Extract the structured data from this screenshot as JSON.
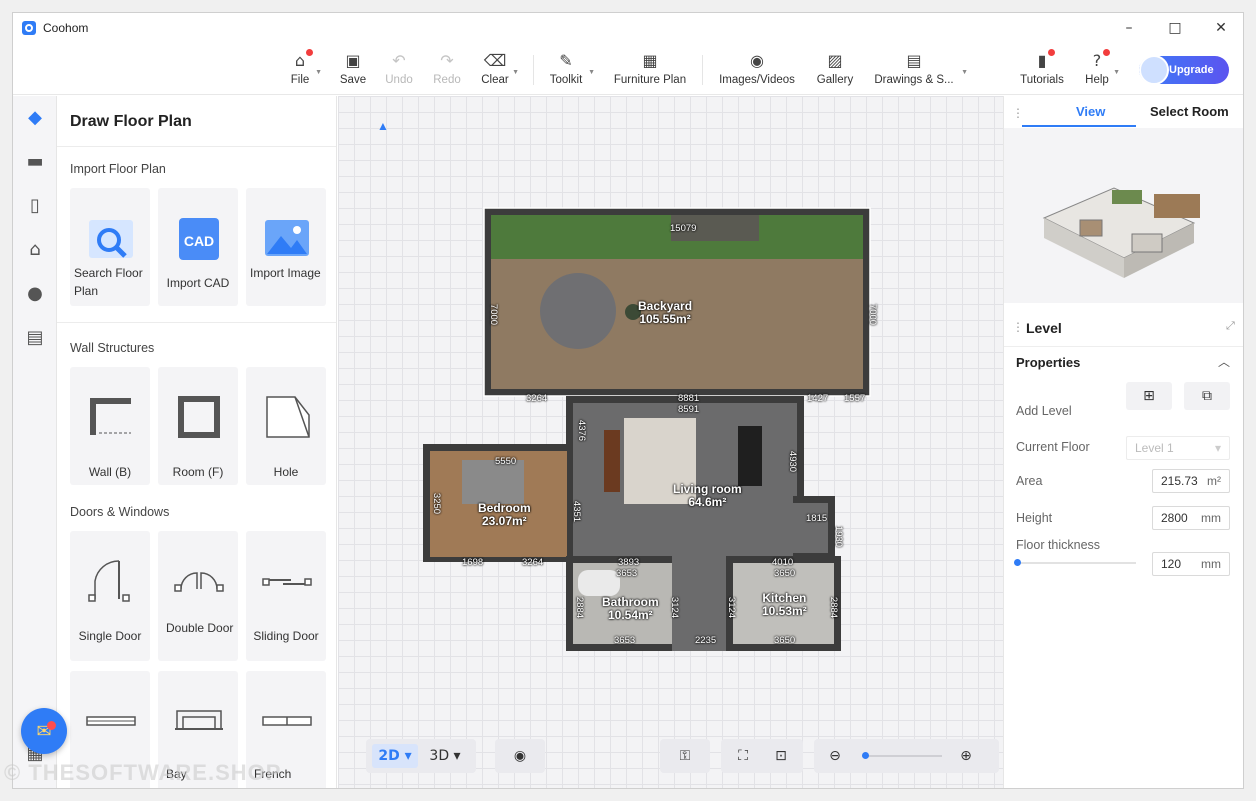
{
  "app": {
    "title": "Coohom"
  },
  "window_controls": {
    "minimize": "–",
    "maximize": "□",
    "close": "✕"
  },
  "toolbar": {
    "file": "File",
    "save": "Save",
    "undo": "Undo",
    "redo": "Redo",
    "clear": "Clear",
    "toolkit": "Toolkit",
    "furniture_plan": "Furniture Plan",
    "images_videos": "Images/Videos",
    "gallery": "Gallery",
    "drawings": "Drawings & S...",
    "tutorials": "Tutorials",
    "help": "Help",
    "upgrade": "Upgrade"
  },
  "left_panel": {
    "title": "Draw Floor Plan",
    "import_section": "Import Floor Plan",
    "import_items": [
      "Search Floor Plan",
      "Import CAD",
      "Import Image"
    ],
    "wall_section": "Wall Structures",
    "wall_items": [
      "Wall (B)",
      "Room (F)",
      "Hole"
    ],
    "doors_section": "Doors & Windows",
    "door_items": [
      "Single Door",
      "Double Door",
      "Sliding Door"
    ],
    "more_items": [
      "Bay",
      "French"
    ]
  },
  "floorplan": {
    "rooms": [
      {
        "name": "Backyard",
        "area": "105.55m²"
      },
      {
        "name": "Living room",
        "area": "64.6m²"
      },
      {
        "name": "Bedroom",
        "area": "23.07m²"
      },
      {
        "name": "Bathroom",
        "area": "10.54m²"
      },
      {
        "name": "Kitchen",
        "area": "10.53m²"
      }
    ],
    "dims": [
      "15079",
      "7000",
      "7000",
      "3264",
      "8881",
      "8591",
      "1427",
      "1557",
      "5550",
      "4376",
      "4930",
      "3250",
      "4351",
      "1815",
      "1930",
      "1698",
      "3264",
      "3893",
      "3653",
      "4010",
      "3650",
      "2884",
      "2884",
      "3124",
      "3124",
      "3653",
      "2235",
      "3650"
    ]
  },
  "canvas_controls": {
    "mode_2d": "2D",
    "mode_3d": "3D"
  },
  "right_panel": {
    "tabs": [
      "View",
      "Select Room"
    ],
    "level_title": "Level",
    "properties_title": "Properties",
    "add_level": "Add Level",
    "current_floor": "Current Floor",
    "current_floor_value": "Level 1",
    "area": "Area",
    "area_value": "215.73",
    "area_unit": "m²",
    "height": "Height",
    "height_value": "2800",
    "height_unit": "mm",
    "floor_thickness": "Floor thickness",
    "floor_thickness_value": "120",
    "floor_thickness_unit": "mm"
  },
  "watermark": "© THESOFTWARE.SHOP",
  "colors": {
    "accent": "#2f7cf6",
    "badge": "#f23d3d"
  }
}
